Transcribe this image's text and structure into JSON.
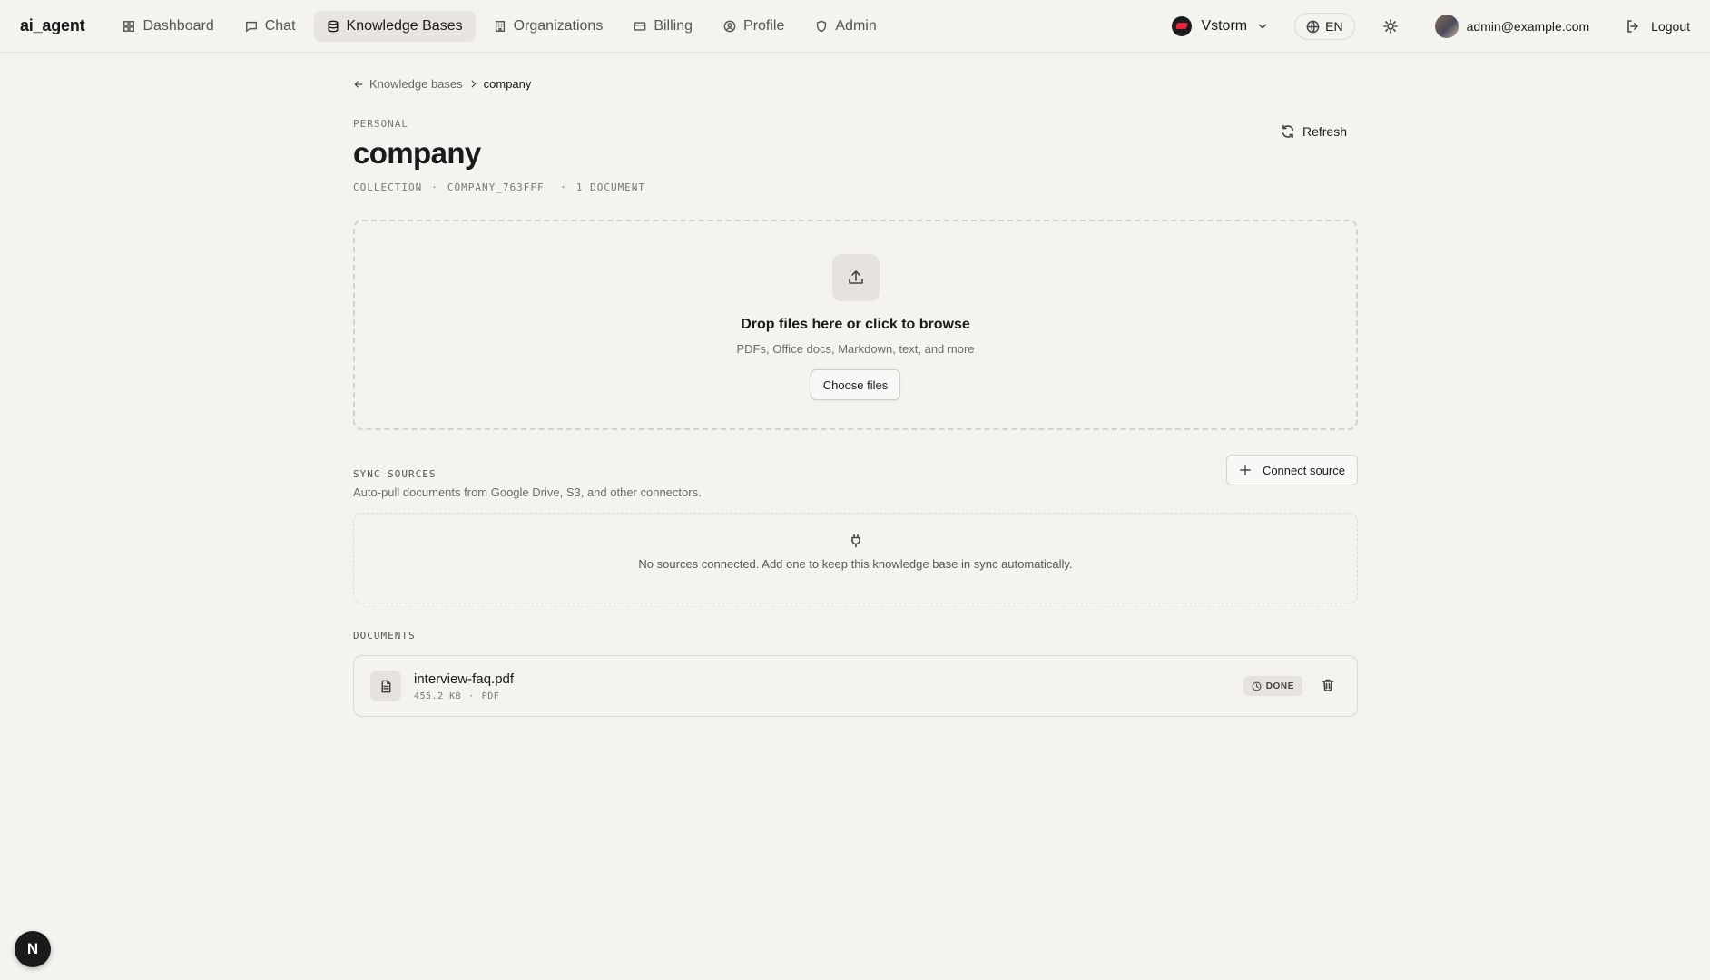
{
  "app": {
    "brand": "ai_agent"
  },
  "nav": {
    "items": [
      {
        "label": "Dashboard",
        "icon": "dashboard-icon"
      },
      {
        "label": "Chat",
        "icon": "chat-icon"
      },
      {
        "label": "Knowledge Bases",
        "icon": "database-icon"
      },
      {
        "label": "Organizations",
        "icon": "building-icon"
      },
      {
        "label": "Billing",
        "icon": "card-icon"
      },
      {
        "label": "Profile",
        "icon": "user-circle-icon"
      },
      {
        "label": "Admin",
        "icon": "shield-icon"
      }
    ],
    "active": "Knowledge Bases"
  },
  "header_right": {
    "org_name": "Vstorm",
    "language": "EN",
    "user_email": "admin@example.com",
    "logout_label": "Logout"
  },
  "breadcrumb": {
    "parent": "Knowledge bases",
    "current": "company"
  },
  "kb": {
    "scope": "PERSONAL",
    "title": "company",
    "collection_label": "COLLECTION",
    "collection_id": "COMPANY_763FFF",
    "doc_count": "1 DOCUMENT",
    "refresh_label": "Refresh"
  },
  "dropzone": {
    "title": "Drop files here or click to browse",
    "subtitle": "PDFs, Office docs, Markdown, text, and more",
    "button": "Choose files"
  },
  "sync": {
    "label": "SYNC SOURCES",
    "description": "Auto-pull documents from Google Drive, S3, and other connectors.",
    "connect_button": "Connect source",
    "empty_text": "No sources connected. Add one to keep this knowledge base in sync automatically."
  },
  "documents": {
    "label": "DOCUMENTS",
    "items": [
      {
        "name": "interview-faq.pdf",
        "size": "455.2 KB",
        "type": "PDF",
        "status": "DONE"
      }
    ]
  },
  "badge": {
    "letter": "N"
  }
}
